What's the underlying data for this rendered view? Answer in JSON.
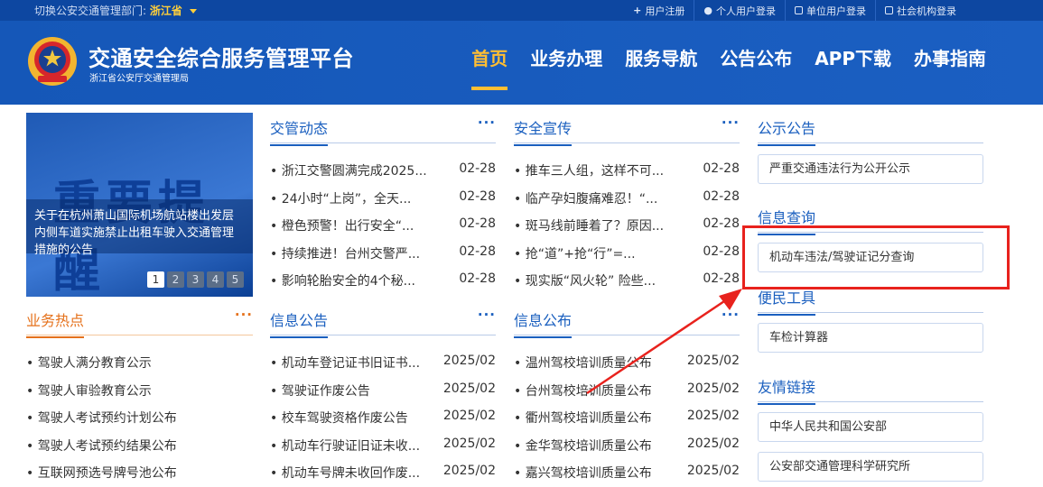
{
  "topbar": {
    "switch_prefix": "切换公安交通管理部门:",
    "province": "浙江省",
    "links": [
      {
        "label": "用户注册",
        "icon": "plus-icon"
      },
      {
        "label": "个人用户登录",
        "icon": "person-icon"
      },
      {
        "label": "单位用户登录",
        "icon": "building-icon"
      },
      {
        "label": "社会机构登录",
        "icon": "building-icon"
      }
    ]
  },
  "header": {
    "title": "交通安全综合服务管理平台",
    "subtitle": "浙江省公安厅交通管理局",
    "nav": [
      "首页",
      "业务办理",
      "服务导航",
      "公告公布",
      "APP下载",
      "办事指南"
    ]
  },
  "banner": {
    "big_text": "重要提醒",
    "caption": "关于在杭州萧山国际机场航站楼出发层内侧车道实施禁止出租车驶入交通管理措施的公告",
    "pages": [
      "1",
      "2",
      "3",
      "4",
      "5"
    ]
  },
  "panels": {
    "jiaoguan": {
      "title": "交管动态",
      "more": "···",
      "items": [
        {
          "text": "• 浙江交警圆满完成2025...",
          "date": "02-28"
        },
        {
          "text": "• 24小时“上岗”，全天...",
          "date": "02-28"
        },
        {
          "text": "• 橙色预警！出行安全“...",
          "date": "02-28"
        },
        {
          "text": "• 持续推进！台州交警严...",
          "date": "02-28"
        },
        {
          "text": "• 影响轮胎安全的4个秘...",
          "date": "02-28"
        }
      ]
    },
    "anquan": {
      "title": "安全宣传",
      "more": "···",
      "items": [
        {
          "text": "• 推车三人组，这样不可...",
          "date": "02-28"
        },
        {
          "text": "• 临产孕妇腹痛难忍！“...",
          "date": "02-28"
        },
        {
          "text": "• 斑马线前睡着了？原因...",
          "date": "02-28"
        },
        {
          "text": "• 抢“道”+抢“行”=...",
          "date": "02-28"
        },
        {
          "text": "• 现实版“风火轮” 险些...",
          "date": "02-28"
        }
      ]
    },
    "yewu": {
      "title": "业务热点",
      "more": "···",
      "items": [
        {
          "text": "• 驾驶人满分教育公示"
        },
        {
          "text": "• 驾驶人审验教育公示"
        },
        {
          "text": "• 驾驶人考试预约计划公布"
        },
        {
          "text": "• 驾驶人考试预约结果公布"
        },
        {
          "text": "• 互联网预选号牌号池公布"
        }
      ]
    },
    "xinxigonggao": {
      "title": "信息公告",
      "more": "···",
      "items": [
        {
          "text": "• 机动车登记证书旧证书...",
          "date": "2025/02"
        },
        {
          "text": "• 驾驶证作废公告",
          "date": "2025/02"
        },
        {
          "text": "• 校车驾驶资格作废公告",
          "date": "2025/02"
        },
        {
          "text": "• 机动车行驶证旧证未收...",
          "date": "2025/02"
        },
        {
          "text": "• 机动车号牌未收回作废...",
          "date": "2025/02"
        }
      ]
    },
    "xinxigongbu": {
      "title": "信息公布",
      "more": "···",
      "items": [
        {
          "text": "• 温州驾校培训质量公布",
          "date": "2025/02"
        },
        {
          "text": "• 台州驾校培训质量公布",
          "date": "2025/02"
        },
        {
          "text": "• 衢州驾校培训质量公布",
          "date": "2025/02"
        },
        {
          "text": "• 金华驾校培训质量公布",
          "date": "2025/02"
        },
        {
          "text": "• 嘉兴驾校培训质量公布",
          "date": "2025/02"
        }
      ]
    }
  },
  "right": {
    "gongshi_title": "公示公告",
    "gongshi_item": "严重交通违法行为公开公示",
    "chaxun_title": "信息查询",
    "chaxun_item": "机动车违法/驾驶证记分查询",
    "bianmin_title": "便民工具",
    "bianmin_item": "车检计算器",
    "youqing_title": "友情链接",
    "youqing_items": [
      "中华人民共和国公安部",
      "公安部交通管理科学研究所"
    ]
  },
  "colors": {
    "brand_blue": "#1a5fbf",
    "orange": "#e5711b",
    "highlight_red": "#e8221d",
    "nav_active": "#ffbe33"
  }
}
